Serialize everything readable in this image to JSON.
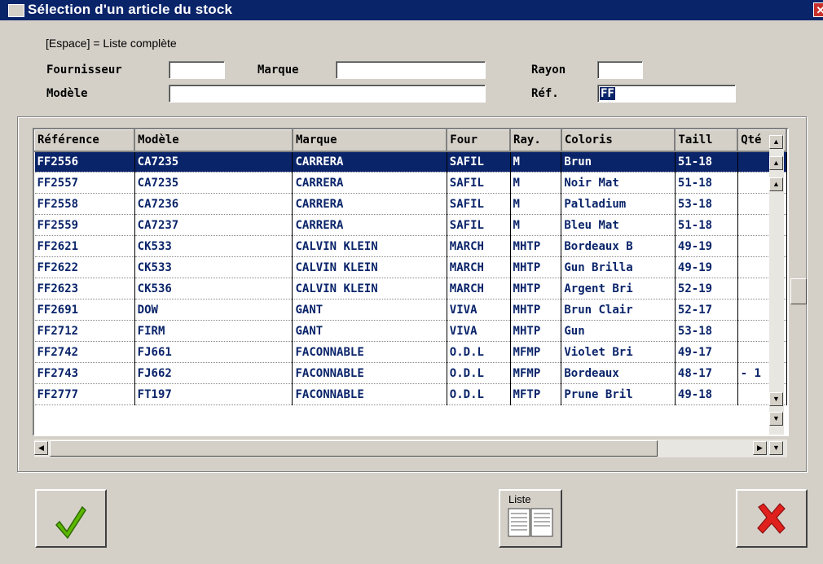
{
  "window": {
    "title": "Sélection d'un article du stock",
    "close_glyph": "✕"
  },
  "hint": "[Espace] = Liste complète",
  "filters": {
    "fournisseur_label": "Fournisseur",
    "fournisseur_value": "",
    "marque_label": "Marque",
    "marque_value": "",
    "rayon_label": "Rayon",
    "rayon_value": "",
    "modele_label": "Modèle",
    "modele_value": "",
    "ref_label": "Réf.",
    "ref_value": "FF"
  },
  "grid": {
    "columns": [
      "Référence",
      "Modèle",
      "Marque",
      "Four",
      "Ray.",
      "Coloris",
      "Taill",
      "Qté"
    ],
    "rows": [
      [
        "FF2556",
        "CA7235",
        "CARRERA",
        "SAFIL",
        "M",
        "Brun",
        "51-18",
        ""
      ],
      [
        "FF2557",
        "CA7235",
        "CARRERA",
        "SAFIL",
        "M",
        "Noir Mat",
        "51-18",
        ""
      ],
      [
        "FF2558",
        "CA7236",
        "CARRERA",
        "SAFIL",
        "M",
        "Palladium",
        "53-18",
        ""
      ],
      [
        "FF2559",
        "CA7237",
        "CARRERA",
        "SAFIL",
        "M",
        "Bleu Mat",
        "51-18",
        ""
      ],
      [
        "FF2621",
        "CK533",
        "CALVIN KLEIN",
        "MARCH",
        "MHTP",
        "Bordeaux B",
        "49-19",
        ""
      ],
      [
        "FF2622",
        "CK533",
        "CALVIN KLEIN",
        "MARCH",
        "MHTP",
        "Gun Brilla",
        "49-19",
        ""
      ],
      [
        "FF2623",
        "CK536",
        "CALVIN KLEIN",
        "MARCH",
        "MHTP",
        "Argent Bri",
        "52-19",
        ""
      ],
      [
        "FF2691",
        "DOW",
        "GANT",
        "VIVA",
        "MHTP",
        "Brun Clair",
        "52-17",
        ""
      ],
      [
        "FF2712",
        "FIRM",
        "GANT",
        "VIVA",
        "MHTP",
        "Gun",
        "53-18",
        ""
      ],
      [
        "FF2742",
        "FJ661",
        "FACONNABLE",
        "O.D.L",
        "MFMP",
        "Violet Bri",
        "49-17",
        ""
      ],
      [
        "FF2743",
        "FJ662",
        "FACONNABLE",
        "O.D.L",
        "MFMP",
        "Bordeaux",
        "48-17",
        "- 1"
      ],
      [
        "FF2777",
        "FT197",
        "FACONNABLE",
        "O.D.L",
        "MFTP",
        "Prune Bril",
        "49-18",
        ""
      ]
    ],
    "selected_row": 0
  },
  "buttons": {
    "liste_label": "Liste"
  },
  "colors": {
    "title_bar": "#0a246a",
    "selection": "#0a246a",
    "ok_check": "#5cb800",
    "cancel_x": "#e0201c"
  }
}
